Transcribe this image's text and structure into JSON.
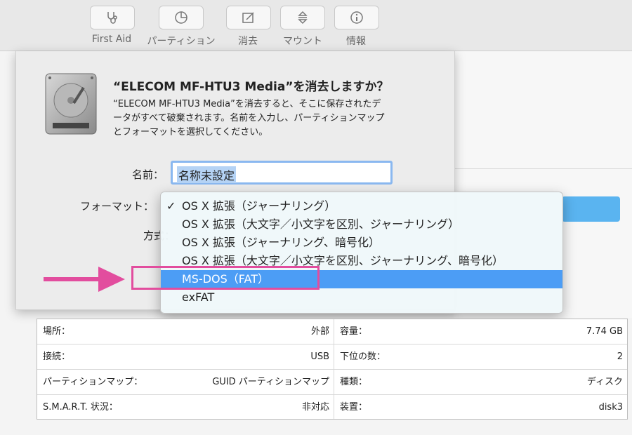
{
  "toolbar": {
    "buttons": [
      {
        "label": "First Aid",
        "icon": "stethoscope-icon"
      },
      {
        "label": "パーティション",
        "icon": "pie-chart-icon"
      },
      {
        "label": "消去",
        "icon": "erase-icon"
      },
      {
        "label": "マウント",
        "icon": "mount-icon"
      },
      {
        "label": "情報",
        "icon": "info-icon"
      }
    ]
  },
  "dialog": {
    "title": "“ELECOM MF-HTU3 Media”を消去しますか？",
    "description_lines": [
      "“ELECOM MF-HTU3 Media”を消去すると、そこに保存されたデ",
      "ータがすべて破棄されます。名前を入力し、パーティションマップ",
      "とフォーマットを選択してください。"
    ],
    "name_label": "名前：",
    "name_value": "名称未設定",
    "format_label": "フォーマット：",
    "scheme_label": "方式："
  },
  "format_menu": {
    "checkmark": "✓",
    "items": [
      "OS X 拡張（ジャーナリング）",
      "OS X 拡張（大文字／小文字を区別、ジャーナリング）",
      "OS X 拡張（ジャーナリング、暗号化）",
      "OS X 拡張（大文字／小文字を区別、ジャーナリング、暗号化）",
      "MS-DOS（FAT）",
      "exFAT"
    ],
    "checked_index": 0,
    "highlighted_index": 4
  },
  "info_table": {
    "left": [
      {
        "key": "場所：",
        "value": "外部"
      },
      {
        "key": "接続：",
        "value": "USB"
      },
      {
        "key": "パーティションマップ：",
        "value": "GUID パーティションマップ"
      },
      {
        "key": "S.M.A.R.T. 状況：",
        "value": "非対応"
      }
    ],
    "right": [
      {
        "key": "容量：",
        "value": "7.74 GB"
      },
      {
        "key": "下位の数：",
        "value": "2"
      },
      {
        "key": "種類：",
        "value": "ディスク"
      },
      {
        "key": "装置：",
        "value": "disk3"
      }
    ]
  },
  "colors": {
    "menu_highlight": "#4c9df5",
    "annotation": "#e24d9e",
    "name_selection": "#b5d3f5"
  }
}
